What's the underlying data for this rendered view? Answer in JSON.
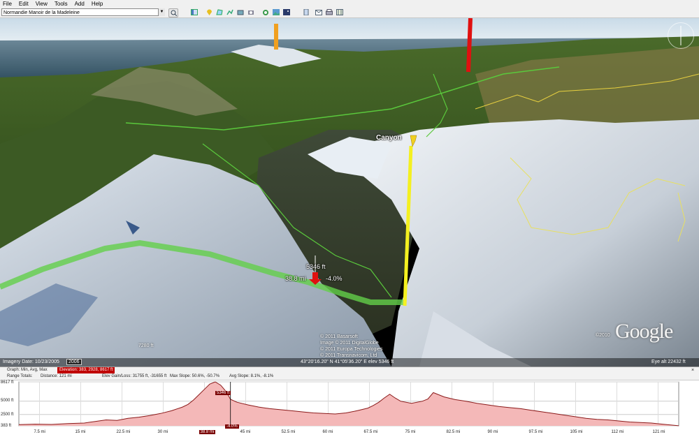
{
  "menu": [
    "File",
    "Edit",
    "View",
    "Tools",
    "Add",
    "Help"
  ],
  "search": {
    "value": "Normandie Manoir de la Madeleine"
  },
  "toolbar_icons": [
    "search-icon",
    "sidebar-icon",
    "placemark-icon",
    "polygon-icon",
    "path-icon",
    "overlay-icon",
    "tour-icon",
    "sky-icon",
    "sun-icon",
    "historical-imagery-icon",
    "ruler-icon",
    "email-icon",
    "print-icon",
    "maps-icon"
  ],
  "view": {
    "placemark_label": "Canyon",
    "cursor_elevation": "5346 ft",
    "cursor_distance": "38.8 mi",
    "cursor_grade": "-4.0%",
    "scale": "7280 ft",
    "copyright": [
      "© 2011 Basarsoft",
      "Image © 2011 DigitalGlobe",
      "© 2011 Europa Technologies",
      "© 2011 Transnavicom, Ltd"
    ],
    "google_logo": "Google",
    "google_year": "©2010"
  },
  "status": {
    "imagery_date": "Imagery Date: 10/23/2005",
    "year": "2006",
    "coordinates": "43°20'16.20\" N   41°05'36.20\" E  elev  5346 ft",
    "eye_alt": "Eye alt  22432 ft"
  },
  "profile": {
    "graph_label": "Graph: Min, Avg, Max",
    "elevation_label": "Elevation: 383, 2928, 8617 ft",
    "range_totals": "Range Totals:",
    "distance": "Distance: 121 mi",
    "gain_loss": "Elev Gain/Loss: 31755 ft, -31655 ft",
    "max_slope": "Max Slope: 50.6%, -50.7%",
    "avg_slope": "Avg Slope: 8.1%, -8.1%",
    "close": "×",
    "y_ticks": [
      "8617 ft",
      "5000 ft",
      "2500 ft",
      "383 ft"
    ],
    "x_ticks": [
      "7.5 mi",
      "15 mi",
      "22.5 mi",
      "30 mi",
      "38.8 mi",
      "45 mi",
      "52.5 mi",
      "60 mi",
      "67.5 mi",
      "75 mi",
      "82.5 mi",
      "90 mi",
      "97.5 mi",
      "105 mi",
      "112 mi",
      "121 mi"
    ],
    "cursor_elevation": "5346 ft",
    "cursor_grade": "-4.0%",
    "fill_color": "#f4b8b8",
    "line_color": "#8b1a1a"
  },
  "chart_data": {
    "type": "area",
    "x": [
      0,
      3,
      6,
      9,
      12,
      14,
      16,
      18,
      20,
      22,
      24,
      26,
      28,
      30,
      31,
      32,
      33,
      34,
      35,
      36,
      37,
      38,
      38.8,
      40,
      42,
      44,
      46,
      48,
      50,
      52,
      54,
      56,
      58,
      60,
      62,
      64,
      65,
      66,
      67,
      68,
      69,
      70,
      72,
      74,
      75,
      76,
      78,
      80,
      82,
      84,
      86,
      88,
      90,
      92,
      94,
      96,
      98,
      100,
      102,
      104,
      106,
      108,
      110,
      112,
      114,
      116,
      118,
      120,
      121
    ],
    "y": [
      600,
      700,
      650,
      800,
      900,
      1200,
      1500,
      1400,
      1800,
      2000,
      2300,
      2700,
      3200,
      3900,
      4400,
      5200,
      6200,
      7200,
      8200,
      8617,
      8000,
      6800,
      5346,
      4800,
      4300,
      3900,
      3600,
      3400,
      3200,
      3000,
      2800,
      2700,
      2600,
      2800,
      3200,
      3700,
      4200,
      4800,
      5600,
      6300,
      5600,
      5000,
      4600,
      5000,
      5400,
      6600,
      5800,
      5300,
      5000,
      4600,
      4300,
      4000,
      3800,
      3600,
      3300,
      3000,
      2700,
      2400,
      2100,
      1800,
      1600,
      1500,
      1300,
      1100,
      1000,
      900,
      700,
      500,
      400
    ],
    "ylim": [
      383,
      8617
    ],
    "xlim": [
      0,
      121
    ]
  }
}
